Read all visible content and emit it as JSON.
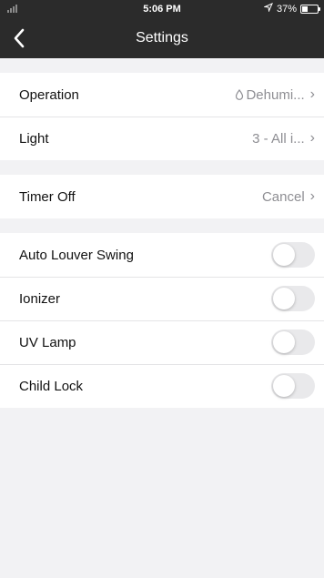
{
  "status_bar": {
    "time": "5:06 PM",
    "battery_text": "37%",
    "battery_level": 0.37
  },
  "nav": {
    "title": "Settings",
    "back_icon": "chevron-left-icon"
  },
  "groups": [
    {
      "rows": [
        {
          "label": "Operation",
          "value": "Dehumi...",
          "icon": "water-drop-icon"
        },
        {
          "label": "Light",
          "value": "3 - All i..."
        }
      ]
    },
    {
      "rows": [
        {
          "label": "Timer Off",
          "value": "Cancel"
        }
      ]
    },
    {
      "rows": [
        {
          "label": "Auto Louver Swing",
          "toggle": false
        },
        {
          "label": "Ionizer",
          "toggle": false
        },
        {
          "label": "UV Lamp",
          "toggle": false
        },
        {
          "label": "Child Lock",
          "toggle": false
        }
      ]
    }
  ],
  "colors": {
    "header_bg": "#2b2b2b",
    "page_bg": "#f2f2f4",
    "toggle_off": "#e9e9eb"
  }
}
